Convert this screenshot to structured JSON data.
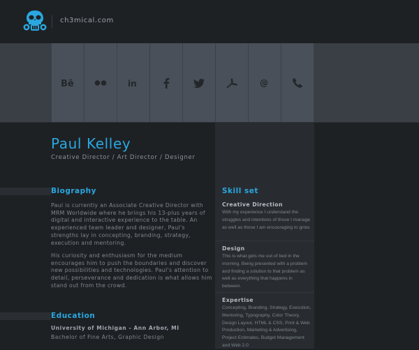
{
  "header": {
    "site_name": "ch3mical.com",
    "logo_icon": "gas-mask-icon"
  },
  "social": {
    "items": [
      {
        "name": "behance",
        "icon": "behance-icon"
      },
      {
        "name": "flickr",
        "icon": "flickr-icon"
      },
      {
        "name": "linkedin",
        "icon": "linkedin-icon"
      },
      {
        "name": "facebook",
        "icon": "facebook-icon"
      },
      {
        "name": "twitter",
        "icon": "twitter-icon"
      },
      {
        "name": "pdf",
        "icon": "pdf-icon"
      },
      {
        "name": "email",
        "icon": "at-icon"
      },
      {
        "name": "phone",
        "icon": "phone-icon"
      }
    ]
  },
  "profile": {
    "name": "Paul Kelley",
    "roles": "Creative Director / Art Director / Designer"
  },
  "biography": {
    "title": "Biography",
    "paragraph_1": "Paul is currently an Associate Creative Director with MRM Worldwide where he brings his 13-plus years of digital and interactive experience to the table. An experienced team leader and designer, Paul's strengths lay in concepting, branding, strategy, execution and mentoring.",
    "paragraph_2": "His curiosity and enthusiasm for the medium encourages him to push the boundaries and discover new possibilities and technologies. Paul's attention to detail, perseverance and dedication is what allows him stand out from the crowd."
  },
  "education": {
    "title": "Education",
    "school": "University of Michigan - Ann Arbor, MI",
    "degree": "Bachelor of Fine Arts, Graphic Design"
  },
  "skills": {
    "title": "Skill set",
    "creative_direction": {
      "heading": "Creative Direction",
      "text": "With my experience I understand the struggles and intentions of those I manage as well as those I am encouraging to grow."
    },
    "design": {
      "heading": "Design",
      "text": "This is what gets me out of bed in the morning. Being presented with a problem and finding a solution to that problem as well as everything that happens in between."
    },
    "expertise": {
      "heading": "Expertise",
      "text": "Concepting, Branding, Strategy, Execution, Mentoring, Typography, Color Theory, Design Layout, HTML & CSS, Print & Web Production, Marketing & Advertising, Project Estimates, Budget Management and Web 2.0"
    }
  },
  "colors": {
    "accent": "#2aa7e0",
    "background": "#1e2124",
    "panel": "#282c31",
    "social_band": "#4a5059"
  }
}
